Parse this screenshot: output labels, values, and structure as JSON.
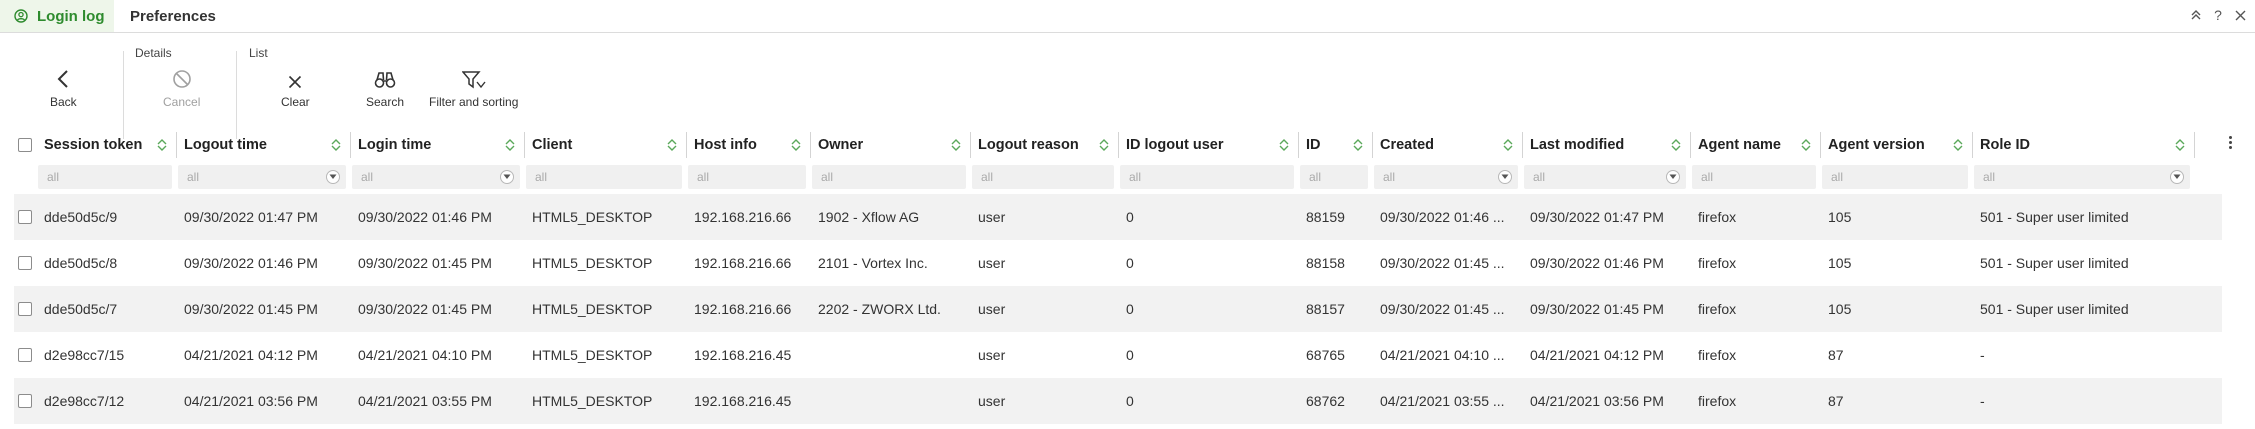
{
  "tabs": [
    {
      "label": "Login log",
      "active": true
    },
    {
      "label": "Preferences",
      "active": false
    }
  ],
  "window_controls": [
    "collapse-icon",
    "help-icon",
    "close-icon"
  ],
  "toolbar": {
    "groups": {
      "details": "Details",
      "list": "List"
    },
    "buttons": {
      "back": "Back",
      "cancel": "Cancel",
      "clear": "Clear",
      "search": "Search",
      "filter": "Filter and sorting"
    }
  },
  "filter_placeholder": "all",
  "columns": [
    "Session token",
    "Logout time",
    "Login time",
    "Client",
    "Host info",
    "Owner",
    "Logout reason",
    "ID logout user",
    "ID",
    "Created",
    "Last modified",
    "Agent name",
    "Agent version",
    "Role ID"
  ],
  "rows": [
    [
      "dde50d5c/9",
      "09/30/2022 01:47 PM",
      "09/30/2022 01:46 PM",
      "HTML5_DESKTOP",
      "192.168.216.66",
      "1902 - Xflow AG",
      "user",
      "0",
      "88159",
      "09/30/2022 01:46 ...",
      "09/30/2022 01:47 PM",
      "firefox",
      "105",
      "501 - Super user limited"
    ],
    [
      "dde50d5c/8",
      "09/30/2022 01:46 PM",
      "09/30/2022 01:45 PM",
      "HTML5_DESKTOP",
      "192.168.216.66",
      "2101 - Vortex Inc.",
      "user",
      "0",
      "88158",
      "09/30/2022 01:45 ...",
      "09/30/2022 01:46 PM",
      "firefox",
      "105",
      "501 - Super user limited"
    ],
    [
      "dde50d5c/7",
      "09/30/2022 01:45 PM",
      "09/30/2022 01:45 PM",
      "HTML5_DESKTOP",
      "192.168.216.66",
      "2202 - ZWORX Ltd.",
      "user",
      "0",
      "88157",
      "09/30/2022 01:45 ...",
      "09/30/2022 01:45 PM",
      "firefox",
      "105",
      "501 - Super user limited"
    ],
    [
      "d2e98cc7/15",
      "04/21/2021 04:12 PM",
      "04/21/2021 04:10 PM",
      "HTML5_DESKTOP",
      "192.168.216.45",
      "",
      "user",
      "0",
      "68765",
      "04/21/2021 04:10 ...",
      "04/21/2021 04:12 PM",
      "firefox",
      "87",
      "-"
    ],
    [
      "d2e98cc7/12",
      "04/21/2021 03:56 PM",
      "04/21/2021 03:55 PM",
      "HTML5_DESKTOP",
      "192.168.216.45",
      "",
      "user",
      "0",
      "68762",
      "04/21/2021 03:55 ...",
      "04/21/2021 03:56 PM",
      "firefox",
      "87",
      "-"
    ]
  ],
  "colors": {
    "accent": "#2e8b2e",
    "active_tab_bg": "#eef6ea",
    "sort_icon": "#5aa85a",
    "row_stripe": "#f2f2f2"
  }
}
